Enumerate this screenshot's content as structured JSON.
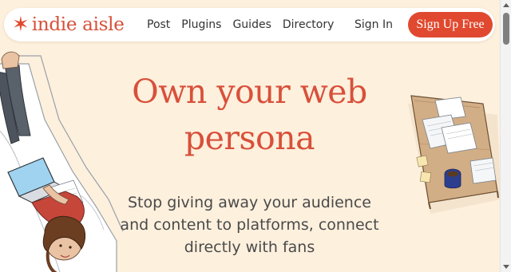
{
  "nav": {
    "brand": {
      "icon": "star-icon",
      "name": "indie aisle"
    },
    "links": [
      {
        "label": "Post"
      },
      {
        "label": "Plugins"
      },
      {
        "label": "Guides"
      },
      {
        "label": "Directory"
      }
    ],
    "sign_in": "Sign In",
    "sign_up": "Sign Up Free"
  },
  "hero": {
    "title_line1": "Own your web",
    "title_line2": "persona",
    "subtitle": "Stop giving away your audience and content to platforms, connect directly with fans"
  },
  "colors": {
    "background": "#fdf0dd",
    "accent": "#e0492f",
    "title": "#d8503a",
    "body_text": "#4a4a4a"
  },
  "illustrations": {
    "left": "woman-on-couch-with-laptop-illustration",
    "right": "table-with-papers-and-coffee-illustration"
  }
}
